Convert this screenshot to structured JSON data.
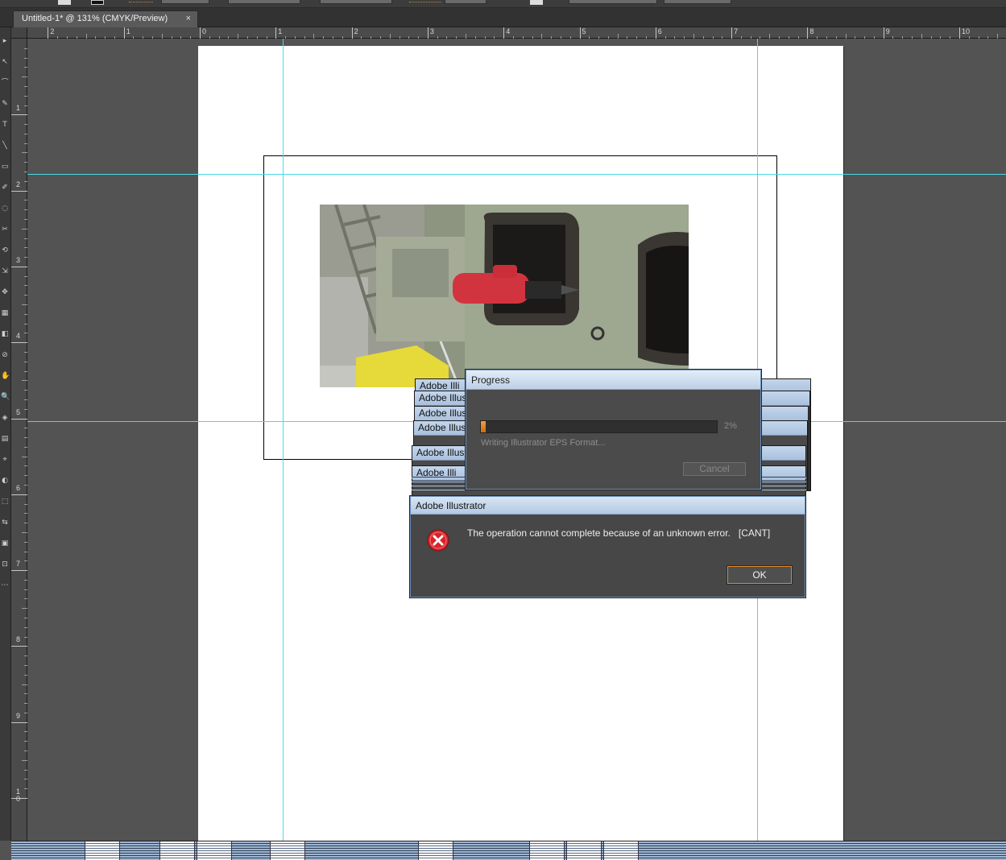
{
  "document_tab": {
    "title": "Untitled-1* @ 131% (CMYK/Preview)",
    "close_glyph": "×"
  },
  "rulers": {
    "horizontal_labels": [
      "2",
      "1",
      "0",
      "1",
      "2",
      "3",
      "4",
      "5",
      "6",
      "7",
      "8",
      "9",
      "10"
    ],
    "vertical_labels": [
      "1",
      "2",
      "3",
      "4",
      "5",
      "6",
      "7",
      "8",
      "9",
      "1\n0"
    ]
  },
  "ghost_dialogs": {
    "title": "Adobe Illustrator",
    "visible_titles": [
      "Adobe Illus",
      "Adobe Illus",
      "Adobe Illus",
      "Adobe Illust",
      "Adobe Illi",
      "Adobe Illi"
    ]
  },
  "progress_dialog": {
    "title": "Progress",
    "percent": 2,
    "percent_label": "2%",
    "status": "Writing Illustrator EPS Format...",
    "cancel_label": "Cancel"
  },
  "error_dialog": {
    "title": "Adobe Illustrator",
    "message": "The operation cannot complete because of an unknown error.",
    "code": "[CANT]",
    "ok_label": "OK",
    "icon": "error-x-icon"
  },
  "colors": {
    "guide": "#4ad8e6",
    "accent_orange": "#e28a2c",
    "dialog_title_blue": "#bdd0e6"
  }
}
